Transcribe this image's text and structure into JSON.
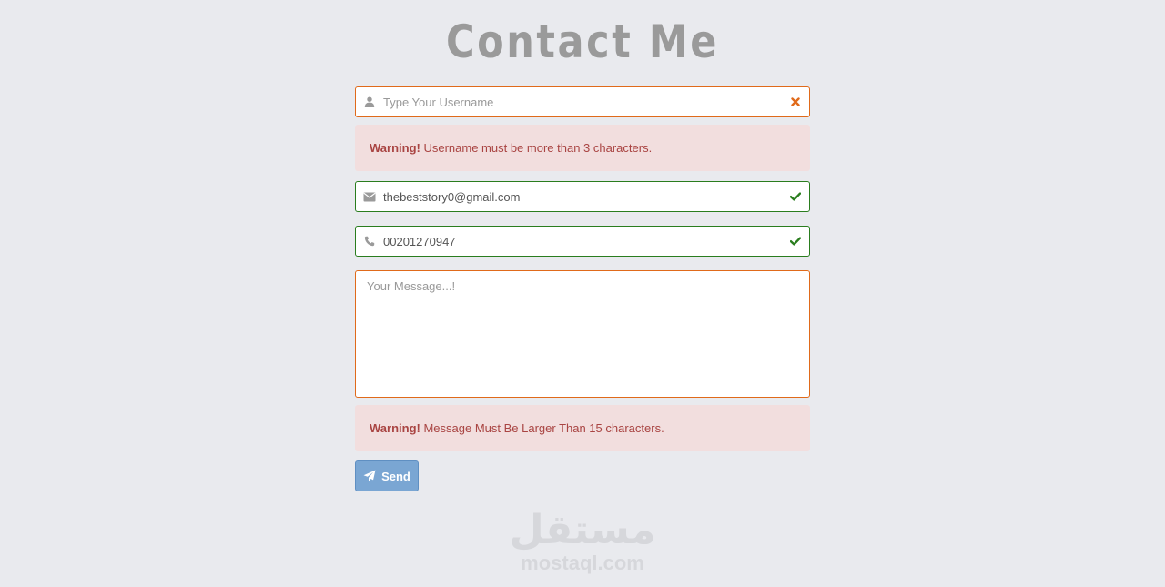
{
  "page": {
    "title": "Contact Me"
  },
  "form": {
    "username": {
      "value": "",
      "placeholder": "Type Your Username",
      "status": "invalid"
    },
    "username_warning": {
      "strong": "Warning!",
      "text": " Username must be more than 3 characters."
    },
    "email": {
      "value": "thebeststory0@gmail.com",
      "status": "valid"
    },
    "phone": {
      "value": "00201270947",
      "status": "valid"
    },
    "message": {
      "value": "",
      "placeholder": "Your Message...!"
    },
    "message_warning": {
      "strong": "Warning!",
      "text": " Message Must Be Larger Than 15 characters."
    },
    "send_label": "Send"
  },
  "watermark": {
    "arabic": "مستقل",
    "latin": "mostaql.com"
  },
  "colors": {
    "background": "#e9eaee",
    "invalid_border": "#e06a1a",
    "valid_border": "#2a7d1e",
    "alert_bg": "#f2dede",
    "alert_text": "#a94442",
    "button_bg": "#7aa6d3"
  }
}
